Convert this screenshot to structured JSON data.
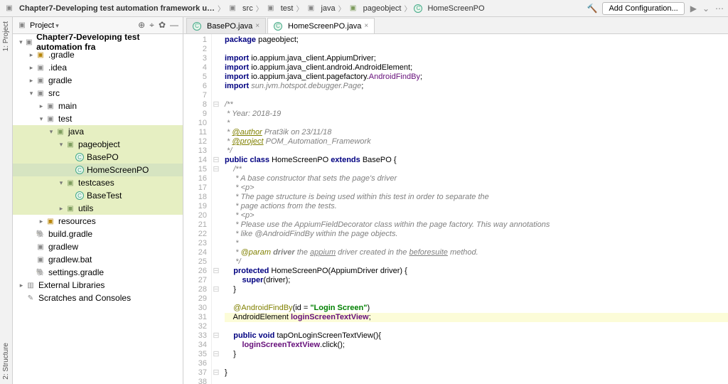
{
  "breadcrumbs": [
    {
      "icon": "folder",
      "label": "Chapter7-Developing test automation framework u…",
      "bold": true
    },
    {
      "icon": "folder",
      "label": "src"
    },
    {
      "icon": "folder",
      "label": "test"
    },
    {
      "icon": "folder",
      "label": "java"
    },
    {
      "icon": "package",
      "label": "pageobject"
    },
    {
      "icon": "class",
      "label": "HomeScreenPO"
    }
  ],
  "toolbar": {
    "add_config": "Add Configuration...",
    "sidebar_title": "Project"
  },
  "rails": {
    "top": "1: Project",
    "bottom": "2: Structure"
  },
  "tree": [
    {
      "d": 0,
      "t": "▾",
      "i": "folder",
      "label": "Chapter7-Developing test automation fra",
      "cls": "proj-root"
    },
    {
      "d": 1,
      "t": "▸",
      "i": "fld",
      "label": ".gradle"
    },
    {
      "d": 1,
      "t": "▸",
      "i": "fldx",
      "label": ".idea"
    },
    {
      "d": 1,
      "t": "▸",
      "i": "fldx",
      "label": "gradle"
    },
    {
      "d": 1,
      "t": "▾",
      "i": "fldx",
      "label": "src"
    },
    {
      "d": 2,
      "t": "▸",
      "i": "fldx",
      "label": "main"
    },
    {
      "d": 2,
      "t": "▾",
      "i": "fldx",
      "label": "test"
    },
    {
      "d": 3,
      "t": "▾",
      "i": "pkg",
      "label": "java",
      "hl": true
    },
    {
      "d": 4,
      "t": "▾",
      "i": "pkg",
      "label": "pageobject",
      "hl": true
    },
    {
      "d": 5,
      "t": "",
      "i": "cls",
      "label": "BasePO",
      "hl": true
    },
    {
      "d": 5,
      "t": "",
      "i": "cls",
      "label": "HomeScreenPO",
      "sel": true
    },
    {
      "d": 4,
      "t": "▾",
      "i": "pkg",
      "label": "testcases",
      "hl": true
    },
    {
      "d": 5,
      "t": "",
      "i": "cls",
      "label": "BaseTest",
      "hl": true
    },
    {
      "d": 4,
      "t": "▸",
      "i": "pkg",
      "label": "utils",
      "hl": true
    },
    {
      "d": 2,
      "t": "▸",
      "i": "fld",
      "label": "resources"
    },
    {
      "d": 1,
      "t": "",
      "i": "gr",
      "label": "build.gradle"
    },
    {
      "d": 1,
      "t": "",
      "i": "file",
      "label": "gradlew"
    },
    {
      "d": 1,
      "t": "",
      "i": "file",
      "label": "gradlew.bat"
    },
    {
      "d": 1,
      "t": "",
      "i": "gr",
      "label": "settings.gradle"
    },
    {
      "d": 0,
      "t": "▸",
      "i": "lib",
      "label": "External Libraries"
    },
    {
      "d": 0,
      "t": "",
      "i": "scr",
      "label": "Scratches and Consoles"
    }
  ],
  "tabs": [
    {
      "label": "BasePO.java",
      "active": false
    },
    {
      "label": "HomeScreenPO.java",
      "active": true
    }
  ],
  "code_lines": [
    {
      "n": 1,
      "h": "<span class='kw'>package</span> pageobject;"
    },
    {
      "n": 2,
      "h": ""
    },
    {
      "n": 3,
      "h": "<span class='kw'>import</span> io.appium.java_client.AppiumDriver;"
    },
    {
      "n": 4,
      "h": "<span class='kw'>import</span> io.appium.java_client.android.AndroidElement;"
    },
    {
      "n": 5,
      "h": "<span class='kw'>import</span> io.appium.java_client.pagefactory.<span class='ref'>AndroidFindBy</span>;"
    },
    {
      "n": 6,
      "h": "<span class='kw'>import</span> <span class='cm'>sun.jvm.hotspot.debugger.Page</span>;"
    },
    {
      "n": 7,
      "h": ""
    },
    {
      "n": 8,
      "h": "<span class='cm'>/**</span>",
      "fold": "⊟"
    },
    {
      "n": 9,
      "h": "<span class='cm'> * Year: 2018-19</span>"
    },
    {
      "n": 10,
      "h": "<span class='cm'> *</span>"
    },
    {
      "n": 11,
      "h": "<span class='cm'> * <span class='ann under'>@author</span> Prat3ik on 23/11/18</span>"
    },
    {
      "n": 12,
      "h": "<span class='cm'> * <span class='ann under'>@project</span> POM_Automation_Framework</span>"
    },
    {
      "n": 13,
      "h": "<span class='cm'> */</span>"
    },
    {
      "n": 14,
      "h": "<span class='kw'>public class</span> HomeScreenPO <span class='kw'>extends</span> BasePO {",
      "fold": "⊟"
    },
    {
      "n": 15,
      "h": "    <span class='cm'>/**</span>",
      "fold": "⊟"
    },
    {
      "n": 16,
      "h": "    <span class='cm'> * A base constructor that sets the page's driver</span>"
    },
    {
      "n": 17,
      "h": "    <span class='cm'> * &lt;p&gt;</span>"
    },
    {
      "n": 18,
      "h": "    <span class='cm'> * The page structure is being used within this test in order to separate the</span>"
    },
    {
      "n": 19,
      "h": "    <span class='cm'> * page actions from the tests.</span>"
    },
    {
      "n": 20,
      "h": "    <span class='cm'> * &lt;p&gt;</span>"
    },
    {
      "n": 21,
      "h": "    <span class='cm'> * Please use the AppiumFieldDecorator class within the page factory. This way annotations</span>"
    },
    {
      "n": 22,
      "h": "    <span class='cm'> * like @AndroidFindBy within the page objects.</span>"
    },
    {
      "n": 23,
      "h": "    <span class='cm'> *</span>"
    },
    {
      "n": 24,
      "h": "    <span class='cm'> * <span class='ann'>@param</span> <b>driver</b> the <span class='under'>appium</span> driver created in the <span class='under'>beforesuite</span> method.</span>"
    },
    {
      "n": 25,
      "h": "    <span class='cm'> */</span>"
    },
    {
      "n": 26,
      "h": "    <span class='kw'>protected</span> HomeScreenPO(AppiumDriver driver) {",
      "fold": "⊟"
    },
    {
      "n": 27,
      "h": "        <span class='kw'>super</span>(driver);"
    },
    {
      "n": 28,
      "h": "    }",
      "fold": "⊟"
    },
    {
      "n": 29,
      "h": ""
    },
    {
      "n": 30,
      "h": "    <span class='ann'>@AndroidFindBy</span>(id = <span class='str'>\"Login Screen\"</span>)",
      "bulb": true
    },
    {
      "n": 31,
      "h": "    AndroidElement <span class='purple'>loginScreenTextView</span>;",
      "cur": true
    },
    {
      "n": 32,
      "h": ""
    },
    {
      "n": 33,
      "h": "    <span class='kw'>public void</span> tapOnLoginScreenTextView(){",
      "fold": "⊟"
    },
    {
      "n": 34,
      "h": "        <span class='purple'>loginScreenTextView</span>.click();"
    },
    {
      "n": 35,
      "h": "    }",
      "fold": "⊟"
    },
    {
      "n": 36,
      "h": ""
    },
    {
      "n": 37,
      "h": "}",
      "fold": "⊟"
    },
    {
      "n": 38,
      "h": ""
    }
  ]
}
